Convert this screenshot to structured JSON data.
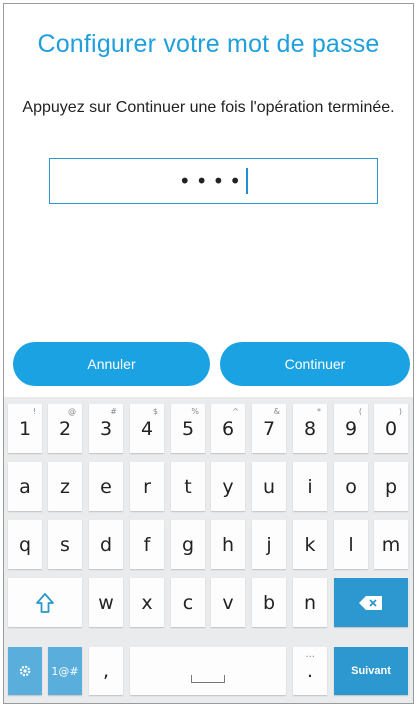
{
  "screen": {
    "title": "Configurer votre mot de passe",
    "instruction": "Appuyez sur Continuer une fois l'opération terminée.",
    "password_value": "••••"
  },
  "buttons": {
    "cancel_label": "Annuler",
    "continue_label": "Continuer"
  },
  "keyboard": {
    "row_numbers": [
      {
        "label": "1",
        "sup": "!"
      },
      {
        "label": "2",
        "sup": "@"
      },
      {
        "label": "3",
        "sup": "#"
      },
      {
        "label": "4",
        "sup": "$"
      },
      {
        "label": "5",
        "sup": "%"
      },
      {
        "label": "6",
        "sup": "^"
      },
      {
        "label": "7",
        "sup": "&"
      },
      {
        "label": "8",
        "sup": "*"
      },
      {
        "label": "9",
        "sup": "("
      },
      {
        "label": "0",
        "sup": ")"
      }
    ],
    "row_1": [
      "a",
      "z",
      "e",
      "r",
      "t",
      "y",
      "u",
      "i",
      "o",
      "p"
    ],
    "row_2": [
      "q",
      "s",
      "d",
      "f",
      "g",
      "h",
      "j",
      "k",
      "l",
      "m"
    ],
    "row_3": [
      "w",
      "x",
      "c",
      "v",
      "b",
      "n"
    ],
    "symbols_label": "1@#",
    "comma_label": ",",
    "period_label": ".",
    "period_sup": "...",
    "next_label": "Suivant",
    "colors": {
      "accent": "#1ba2e3",
      "action_key": "#2d97cf",
      "keyboard_bg": "#e9ebec"
    },
    "icons": {
      "shift": "shift-arrow-icon",
      "backspace": "backspace-icon",
      "settings": "gear-icon",
      "space": "spacebar-icon"
    }
  }
}
